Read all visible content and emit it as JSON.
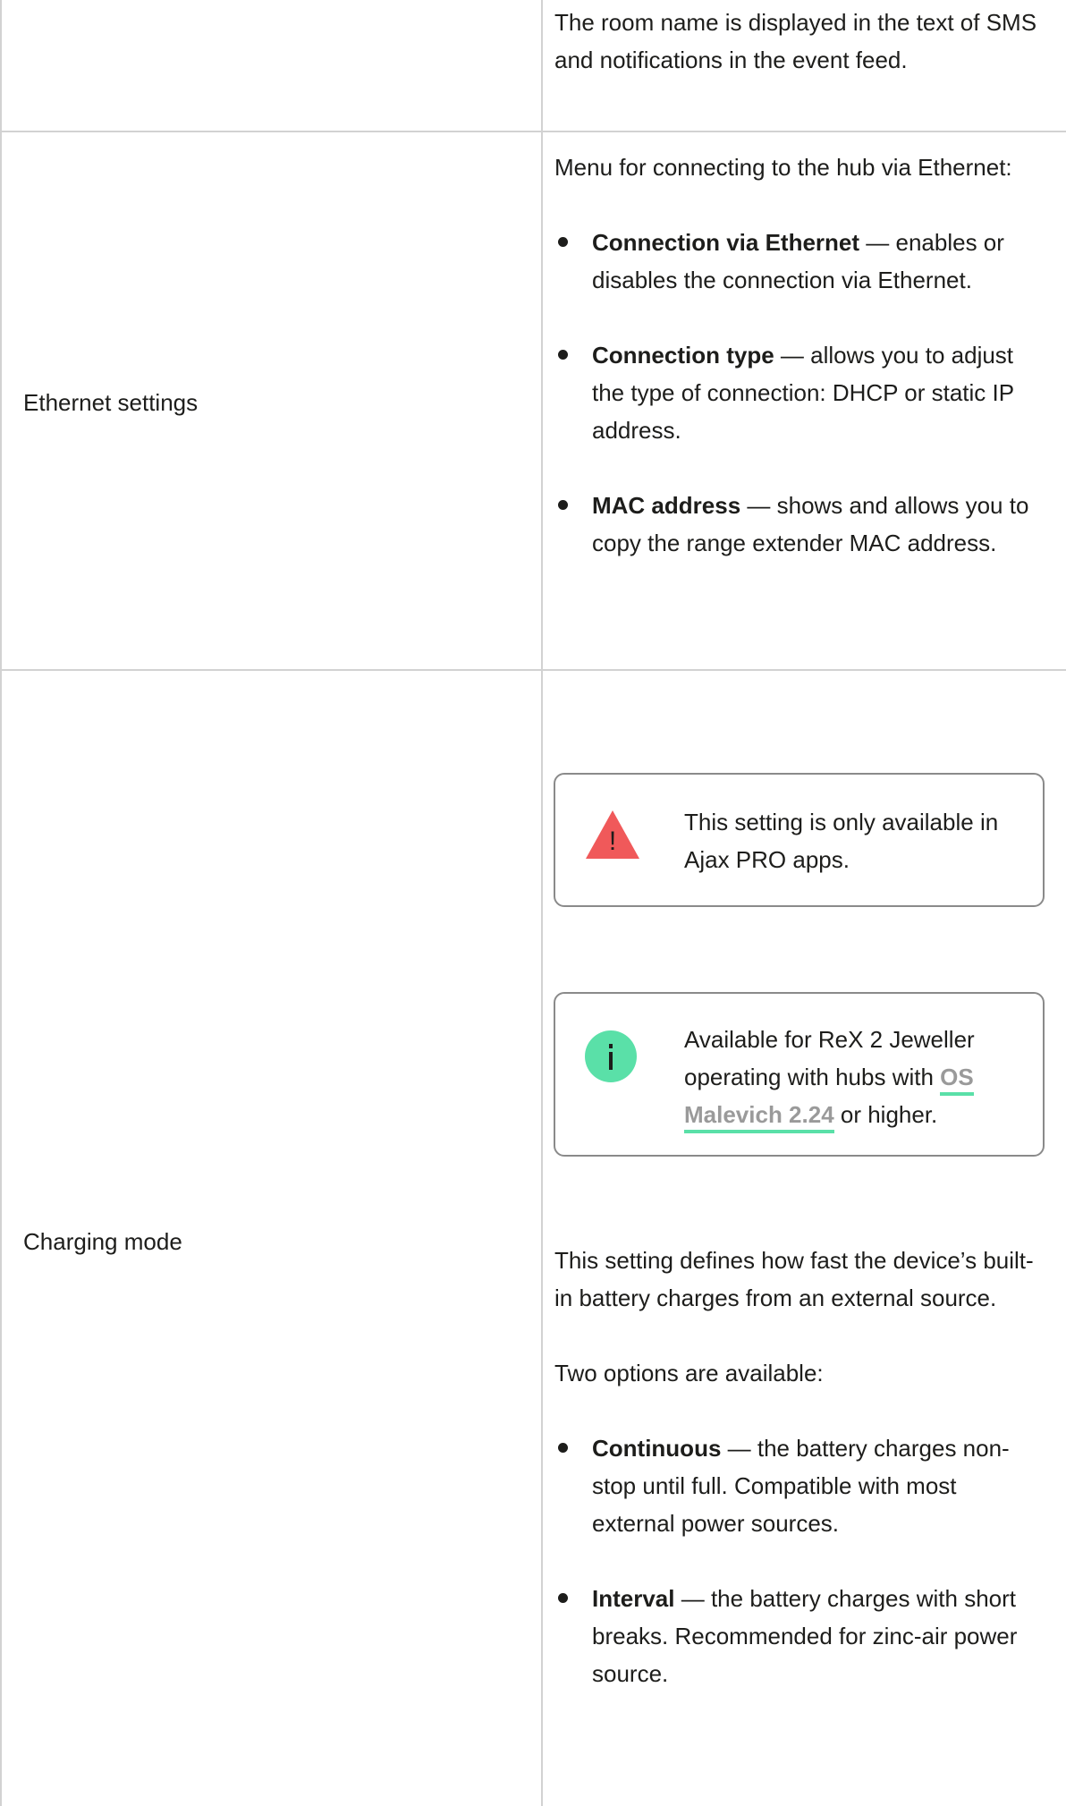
{
  "room_row": {
    "description": "The room name is displayed in the text of SMS and notifications in the event feed."
  },
  "ethernet_row": {
    "label": "Ethernet settings",
    "intro": "Menu for connecting to the hub via Ethernet:",
    "items": [
      {
        "term": "Connection via Ethernet",
        "text": " — enables or disables the connection via Ethernet."
      },
      {
        "term": "Connection type",
        "text": " — allows you to adjust the type of connection: DHCP or static IP address."
      },
      {
        "term": "MAC address",
        "text": " — shows and allows you to copy the range extender MAC address."
      }
    ]
  },
  "charging_row": {
    "label": "Charging mode",
    "warning": {
      "icon": "warning-triangle-icon",
      "color": "#f0595a",
      "text": "This setting is only available in Ajax PRO apps."
    },
    "info": {
      "icon": "info-icon",
      "color": "#5ae0a8",
      "text_before": "Available for ReX 2 Jeweller operating with hubs with ",
      "link_text": "OS Malevich 2.24",
      "text_after": " or higher."
    },
    "description": "This setting defines how fast the device’s built-in battery charges from an external source.",
    "options_intro": "Two options are available:",
    "items": [
      {
        "term": "Continuous",
        "text": " — the battery charges non-stop until full. Compatible with most external power sources."
      },
      {
        "term": "Interval",
        "text": " — the battery charges with short breaks. Recommended for zinc-air power source."
      }
    ]
  },
  "colors": {
    "border": "#d2d2d2",
    "callout_border": "#8a8a8a",
    "link_underline": "#5ae0a8",
    "link_text": "#9a9a9a",
    "text": "#1d1d1b"
  }
}
